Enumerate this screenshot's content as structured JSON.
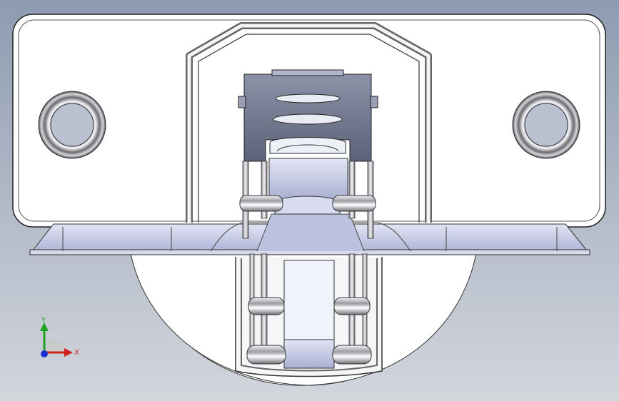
{
  "viewport": {
    "background_top": "#8e9bb0",
    "background_bottom": "#d2d6dd"
  },
  "triad": {
    "x_label": "X",
    "y_label": "Y",
    "x_color": "#d0201c",
    "y_color": "#1fa31f",
    "z_color": "#1c2fd0"
  },
  "model": {
    "plate_color": "#ffffff",
    "steel_color": "#e4e6ee",
    "blue_part_color": "#c6cbe6",
    "dark_part_color": "#6b7389"
  }
}
